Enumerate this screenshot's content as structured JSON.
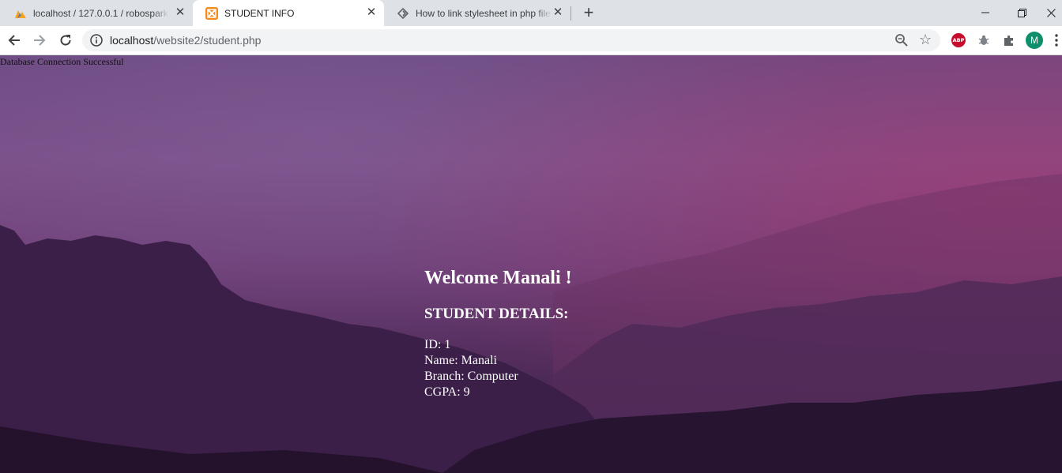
{
  "browser": {
    "tabs": [
      {
        "title": "localhost / 127.0.0.1 / robospark",
        "favicon": "phpmyadmin-icon",
        "active": false
      },
      {
        "title": "STUDENT INFO",
        "favicon": "xampp-icon",
        "active": true
      },
      {
        "title": "How to link stylesheet in php file",
        "favicon": "stackoverflow-icon",
        "active": false
      }
    ],
    "url_host": "localhost",
    "url_path": "/website2/student.php",
    "profile_initial": "M",
    "abp_label": "ABP"
  },
  "page": {
    "db_message": "Database Connection Successful",
    "welcome": "Welcome Manali !",
    "details_heading": "STUDENT DETAILS:",
    "fields": [
      {
        "label": "ID",
        "value": "1",
        "text": "ID: 1"
      },
      {
        "label": "Name",
        "value": "Manali",
        "text": "Name: Manali"
      },
      {
        "label": "Branch",
        "value": "Computer",
        "text": "Branch: Computer"
      },
      {
        "label": "CGPA",
        "value": "9",
        "text": "CGPA: 9"
      }
    ]
  },
  "colors": {
    "tabstrip": "#dee1e6",
    "profile_avatar": "#0f8f6b",
    "abp": "#c70d2c",
    "page_text": "#ffffff"
  }
}
